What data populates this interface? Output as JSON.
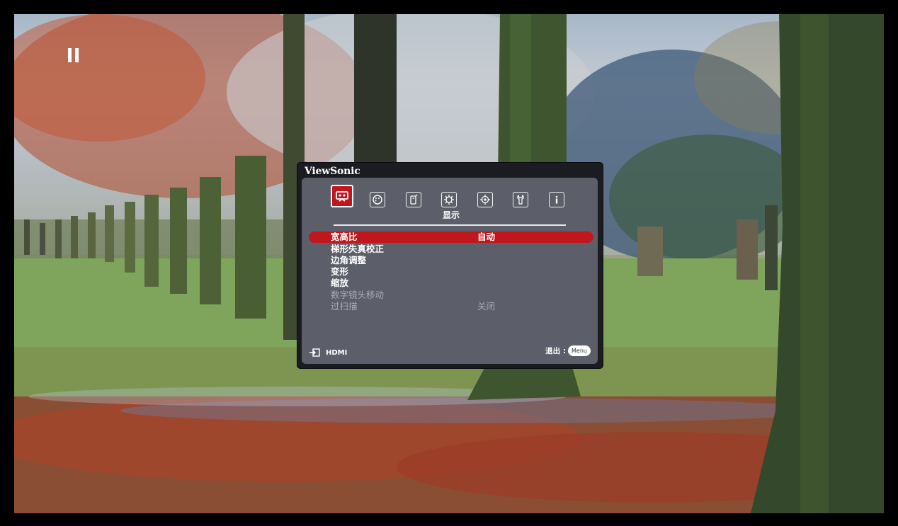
{
  "brand": "ViewSonic",
  "tabs": [
    {
      "icon": "display-icon",
      "active": true
    },
    {
      "icon": "picture-palette-icon",
      "active": false
    },
    {
      "icon": "audio-remote-icon",
      "active": false
    },
    {
      "icon": "basic-settings-gear-icon",
      "active": false
    },
    {
      "icon": "advanced-settings-gear-icon",
      "active": false
    },
    {
      "icon": "system-wrench-icon",
      "active": false
    },
    {
      "icon": "information-icon",
      "active": false
    }
  ],
  "active_tab_label": "显示",
  "menu": {
    "items": [
      {
        "label": "宽高比",
        "value": "自动",
        "selected": true,
        "enabled": true
      },
      {
        "label": "梯形失真校正",
        "value": "",
        "selected": false,
        "enabled": true
      },
      {
        "label": "边角调整",
        "value": "",
        "selected": false,
        "enabled": true
      },
      {
        "label": "变形",
        "value": "",
        "selected": false,
        "enabled": true
      },
      {
        "label": "缩放",
        "value": "",
        "selected": false,
        "enabled": true
      },
      {
        "label": "数字镜头移动",
        "value": "",
        "selected": false,
        "enabled": false
      },
      {
        "label": "过扫描",
        "value": "关闭",
        "selected": false,
        "enabled": false
      }
    ]
  },
  "footer": {
    "source": "HDMI",
    "exit_label": "退出 :",
    "menu_button": "Menu"
  },
  "colors": {
    "accent": "#c0161d",
    "panel": "#5c5f6a",
    "frame": "#1a1c22"
  }
}
